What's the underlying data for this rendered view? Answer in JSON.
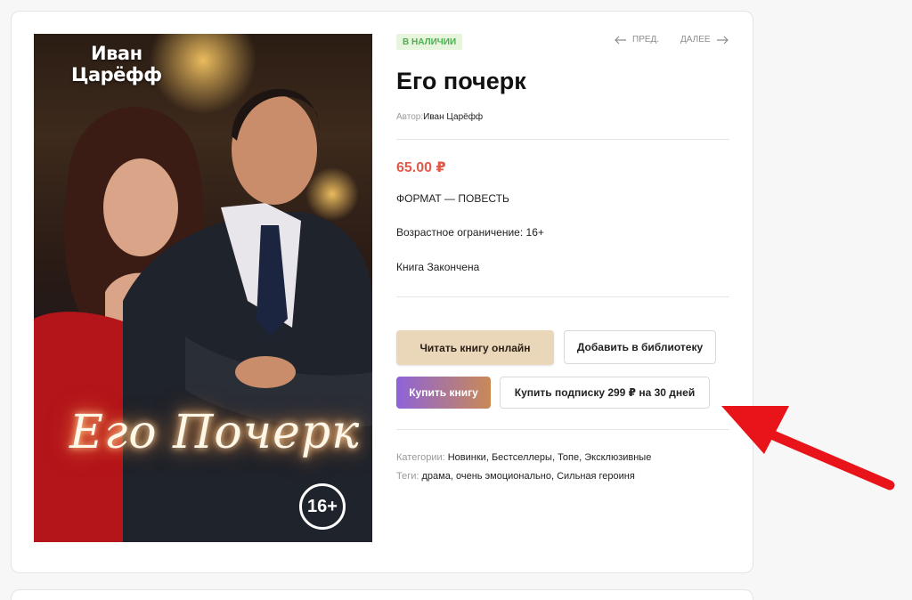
{
  "product": {
    "cover": {
      "author_line1": "Иван",
      "author_line2": "Царёфф",
      "title": "Его Почерк",
      "age": "16+"
    },
    "badge": "В НАЛИЧИИ",
    "nav": {
      "prev": "ПРЕД.",
      "next": "ДАЛЕЕ"
    },
    "title": "Его почерк",
    "author_label": "Автор:",
    "author_name": "Иван Царёфф",
    "price": "65.00 ₽",
    "format": "ФОРМАТ — ПОВЕСТЬ",
    "age_limit": "Возрастное ограничение: 16+",
    "status": "Книга Закончена",
    "buttons": {
      "read_online": "Читать книгу онлайн",
      "add_library": "Добавить в библиотеку",
      "buy": "Купить книгу",
      "subscribe": "Купить подписку 299 ₽ на 30 дней"
    },
    "categories_label": "Категории:",
    "categories": [
      "Новинки",
      "Бестселлеры",
      "Топе",
      "Эксклюзивные"
    ],
    "tags_label": "Теги:",
    "tags": [
      "драма",
      "очень эмоционально",
      "Сильная героиня"
    ]
  },
  "colors": {
    "price": "#e05a4a",
    "badge_text": "#4caf50",
    "badge_bg": "#e6f5dc",
    "read_button": "#ead7b9",
    "arrow": "#e8141a"
  },
  "icons": {
    "prev": "arrow-left-icon",
    "next": "arrow-right-icon",
    "annotation": "red-pointer-arrow"
  }
}
